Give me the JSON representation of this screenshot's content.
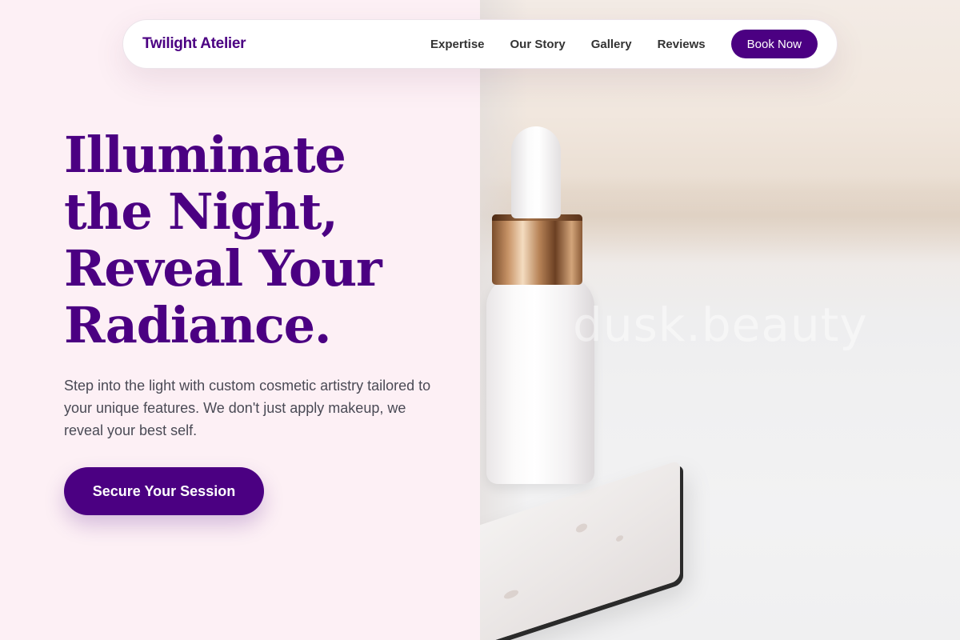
{
  "nav": {
    "brand": "Twilight Atelier",
    "links": [
      "Expertise",
      "Our Story",
      "Gallery",
      "Reviews"
    ],
    "cta_label": "Book Now"
  },
  "hero": {
    "title_lines": [
      "Illuminate",
      "the Night,",
      "Reveal Your",
      "Radiance."
    ],
    "description": "Step into the light with custom cosmetic artistry tailored to your unique features. We don't just apply makeup, we reveal your best self.",
    "cta_label": "Secure Your Session"
  },
  "image": {
    "watermark": "dusk.beauty",
    "subject": "serum-dropper-bottle-on-marble-tray"
  },
  "colors": {
    "accent": "#4b0082",
    "background": "#fdf0f5",
    "text": "#4a4a55"
  }
}
